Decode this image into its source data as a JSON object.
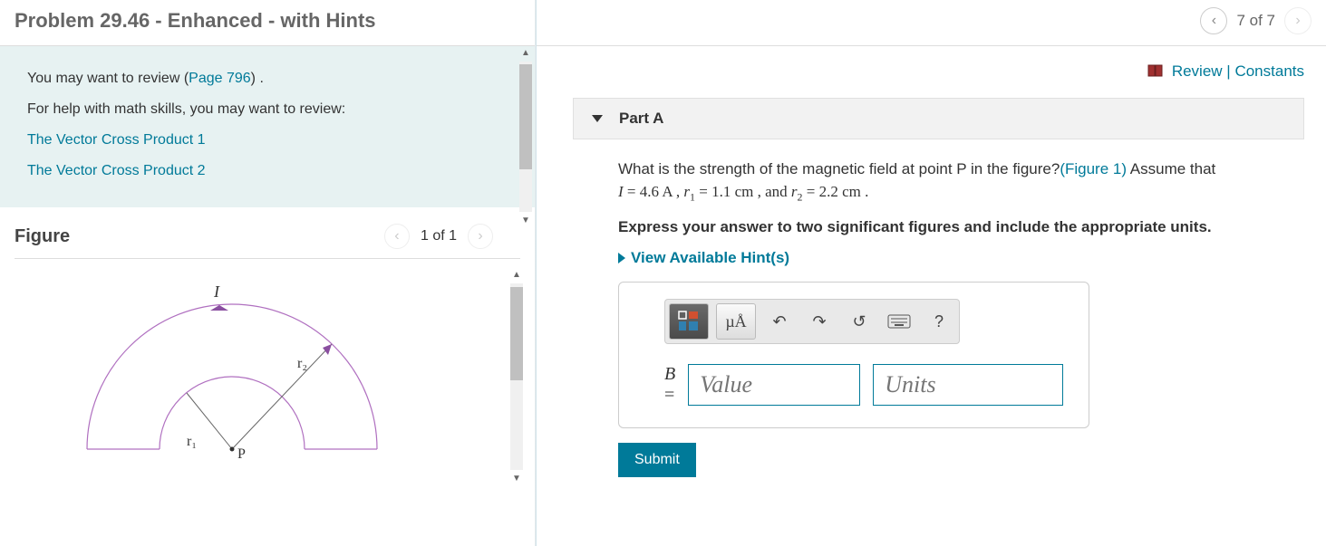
{
  "header": {
    "title": "Problem 29.46 - Enhanced - with Hints",
    "position": "7 of 7"
  },
  "hintsPanel": {
    "reviewPrefix": "You may want to review (",
    "reviewLink": "Page 796",
    "reviewSuffix": ") .",
    "mathHelp": "For help with math skills, you may want to review:",
    "link1": "The Vector Cross Product 1",
    "link2": "The Vector Cross Product 2"
  },
  "figure": {
    "title": "Figure",
    "position": "1 of 1",
    "labels": {
      "I": "I",
      "r1": "r₁",
      "r2": "r₂",
      "P": "P"
    }
  },
  "topLinks": {
    "review": "Review",
    "sep": " | ",
    "constants": "Constants"
  },
  "partA": {
    "label": "Part A",
    "q1": "What is the strength of the magnetic field at point P in the figure?",
    "figLink": "(Figure 1)",
    "q2": " Assume that ",
    "formula": {
      "I": "I",
      "eq": " = 4.6 ",
      "A": "A",
      "sep1": " , ",
      "r": "r",
      "sub1": "1",
      "v1": " = 1.1 ",
      "cm": "cm",
      "sep2": " , and ",
      "sub2": "2",
      "v2": " = 2.2 ",
      "end": " ."
    },
    "instruction": "Express your answer to two significant figures and include the appropriate units.",
    "hintsLink": "View Available Hint(s)",
    "toolbar": {
      "units": "µÅ",
      "help": "?"
    },
    "answer": {
      "label": "B",
      "eq": " = ",
      "valuePlaceholder": "Value",
      "unitsPlaceholder": "Units"
    },
    "submit": "Submit"
  }
}
